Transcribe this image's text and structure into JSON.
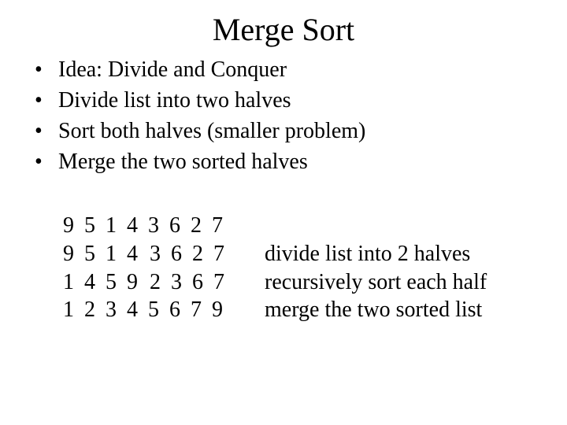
{
  "title": "Merge Sort",
  "bullets": [
    "Idea: Divide and Conquer",
    "Divide list into two halves",
    "Sort both halves (smaller problem)",
    "Merge the two sorted halves"
  ],
  "example": {
    "row1_full": "9 5 1 4 3 6 2 7",
    "row2_left": "9 5 1 4",
    "row2_right": "3 6 2 7",
    "row2_caption": "divide list into 2 halves",
    "row3_left": "1 4 5 9",
    "row3_right": "2 3 6 7",
    "row3_caption": "recursively sort each half",
    "row4_full": "1 2 3 4 5 6 7 9",
    "row4_caption": "merge the two sorted list"
  }
}
